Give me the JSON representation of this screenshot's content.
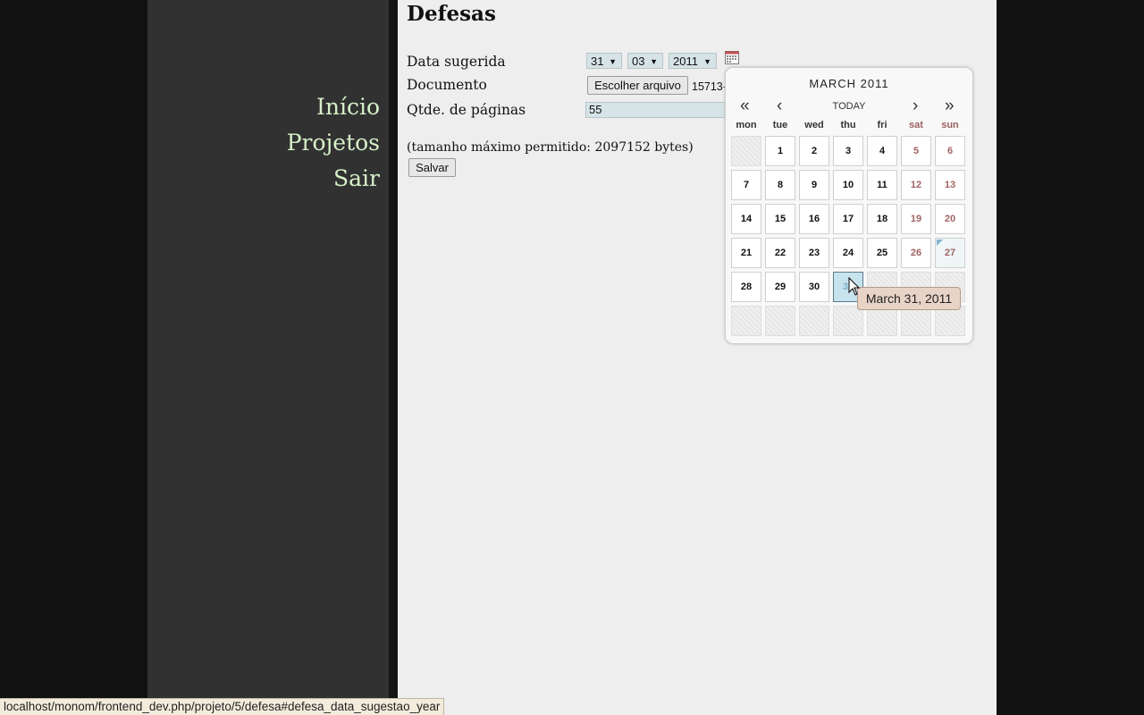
{
  "nav": {
    "items": [
      "Início",
      "Projetos",
      "Sair"
    ]
  },
  "page": {
    "title": "Defesas"
  },
  "form": {
    "date_label": "Data sugerida",
    "day": "31",
    "month": "03",
    "year": "2011",
    "doc_label": "Documento",
    "file_button": "Escolher arquivo",
    "file_name": "15713-",
    "pages_label": "Qtde. de páginas",
    "pages_value": "55",
    "size_note": "(tamanho máximo permitido: 2097152 bytes)",
    "save_button": "Salvar"
  },
  "calendar": {
    "title": "MARCH 2011",
    "prev_year": "«",
    "prev_month": "‹",
    "today": "TODAY",
    "next_month": "›",
    "next_year": "»",
    "weekdays": [
      "mon",
      "tue",
      "wed",
      "thu",
      "fri",
      "sat",
      "sun"
    ],
    "days": [
      "1",
      "2",
      "3",
      "4",
      "5",
      "6",
      "7",
      "8",
      "9",
      "10",
      "11",
      "12",
      "13",
      "14",
      "15",
      "16",
      "17",
      "18",
      "19",
      "20",
      "21",
      "22",
      "23",
      "24",
      "25",
      "26",
      "27",
      "28",
      "29",
      "30",
      "31"
    ],
    "leading_empty": 1,
    "today_day": "27",
    "hover_day": "31",
    "tooltip": "March 31, 2011"
  },
  "status_bar": {
    "url": "localhost/monom/frontend_dev.php/projeto/5/defesa#defesa_data_sugestao_year"
  },
  "colors": {
    "nav_link": "#d6f0c8",
    "sidebar": "#313131",
    "weekend": "#a06464",
    "hover_day": "#c7e3ee"
  }
}
